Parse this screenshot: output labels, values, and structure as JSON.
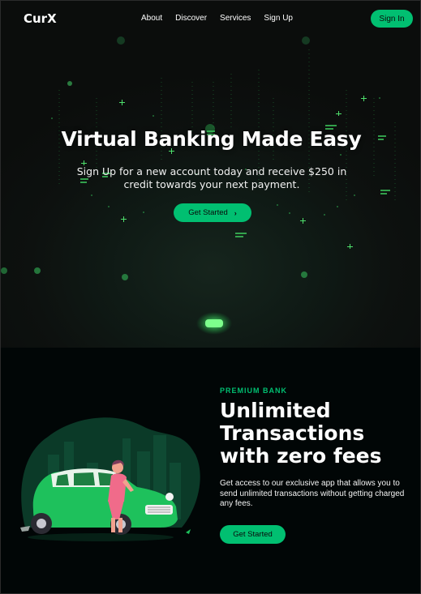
{
  "nav": {
    "logo": "CurX",
    "links": [
      "About",
      "Discover",
      "Services",
      "Sign Up"
    ],
    "signin_label": "Sign In"
  },
  "hero": {
    "title": "Virtual Banking Made Easy",
    "subtitle": "Sign Up for a new account today and receive $250 in credit towards your next payment.",
    "button_label": "Get Started",
    "button_icon": "chevron-right-icon"
  },
  "info": {
    "tag": "PREMIUM BANK",
    "title": "Unlimited Transactions with zero fees",
    "description": "Get access to our exclusive app that allows you to send unlimited transactions without getting charged any fees.",
    "button_label": "Get Started"
  },
  "colors": {
    "accent": "#01bf71",
    "background": "#010606"
  }
}
